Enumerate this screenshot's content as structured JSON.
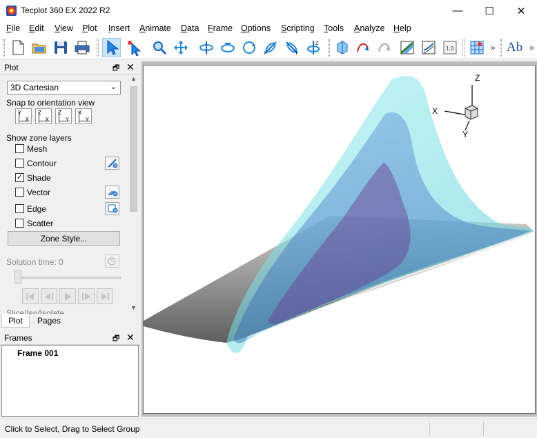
{
  "window": {
    "title": "Tecplot 360 EX 2022 R2",
    "controls": {
      "minimize": "—",
      "maximize": "☐",
      "close": "✕"
    }
  },
  "menu": [
    {
      "label": "File",
      "key": "F",
      "rest": "ile"
    },
    {
      "label": "Edit",
      "key": "E",
      "rest": "dit"
    },
    {
      "label": "View",
      "key": "V",
      "rest": "iew"
    },
    {
      "label": "Plot",
      "key": "P",
      "rest": "lot"
    },
    {
      "label": "Insert",
      "key": "I",
      "rest": "nsert"
    },
    {
      "label": "Animate",
      "key": "A",
      "rest": "nimate"
    },
    {
      "label": "Data",
      "key": "D",
      "rest": "ata"
    },
    {
      "label": "Frame",
      "key": "F",
      "rest": "rame"
    },
    {
      "label": "Options",
      "key": "O",
      "rest": "ptions"
    },
    {
      "label": "Scripting",
      "key": "S",
      "rest": "cripting"
    },
    {
      "label": "Tools",
      "key": "T",
      "rest": "ools"
    },
    {
      "label": "Analyze",
      "key": "A",
      "rest": "nalyze"
    },
    {
      "label": "Help",
      "key": "H",
      "rest": "elp"
    }
  ],
  "toolbar": {
    "overflow_1": "»",
    "overflow_2": "»",
    "text_tool": "Ab"
  },
  "plot_panel": {
    "title": "Plot",
    "pin": "🗗",
    "close": "✕",
    "plot_type": "3D Cartesian",
    "snap_label": "Snap to orientation view",
    "orient_views": [
      {
        "a": "Y",
        "b": "X"
      },
      {
        "a": "Z",
        "b": "X"
      },
      {
        "a": "Z",
        "b": "Y"
      },
      {
        "a": "X",
        "b": "Y"
      }
    ],
    "layers_label": "Show zone layers",
    "layers": [
      {
        "label": "Mesh",
        "checked": false
      },
      {
        "label": "Contour",
        "checked": false
      },
      {
        "label": "Shade",
        "checked": true
      },
      {
        "label": "Vector",
        "checked": false
      },
      {
        "label": "Edge",
        "checked": false
      },
      {
        "label": "Scatter",
        "checked": false
      }
    ],
    "check_mark": "✓",
    "zone_style_button": "Zone Style...",
    "solution_time_label": "Solution time:",
    "solution_time_value": "0",
    "cut_off_text": "Slice/Iso/Isolate"
  },
  "tabs": {
    "plot": "Plot",
    "pages": "Pages"
  },
  "frames_panel": {
    "title": "Frames",
    "pin": "🗗",
    "close": "✕",
    "items": [
      "Frame 001"
    ]
  },
  "axis_triad": {
    "x": "X",
    "y": "Y",
    "z": "Z"
  },
  "status": {
    "message": "Click to Select, Drag to Select Group"
  }
}
